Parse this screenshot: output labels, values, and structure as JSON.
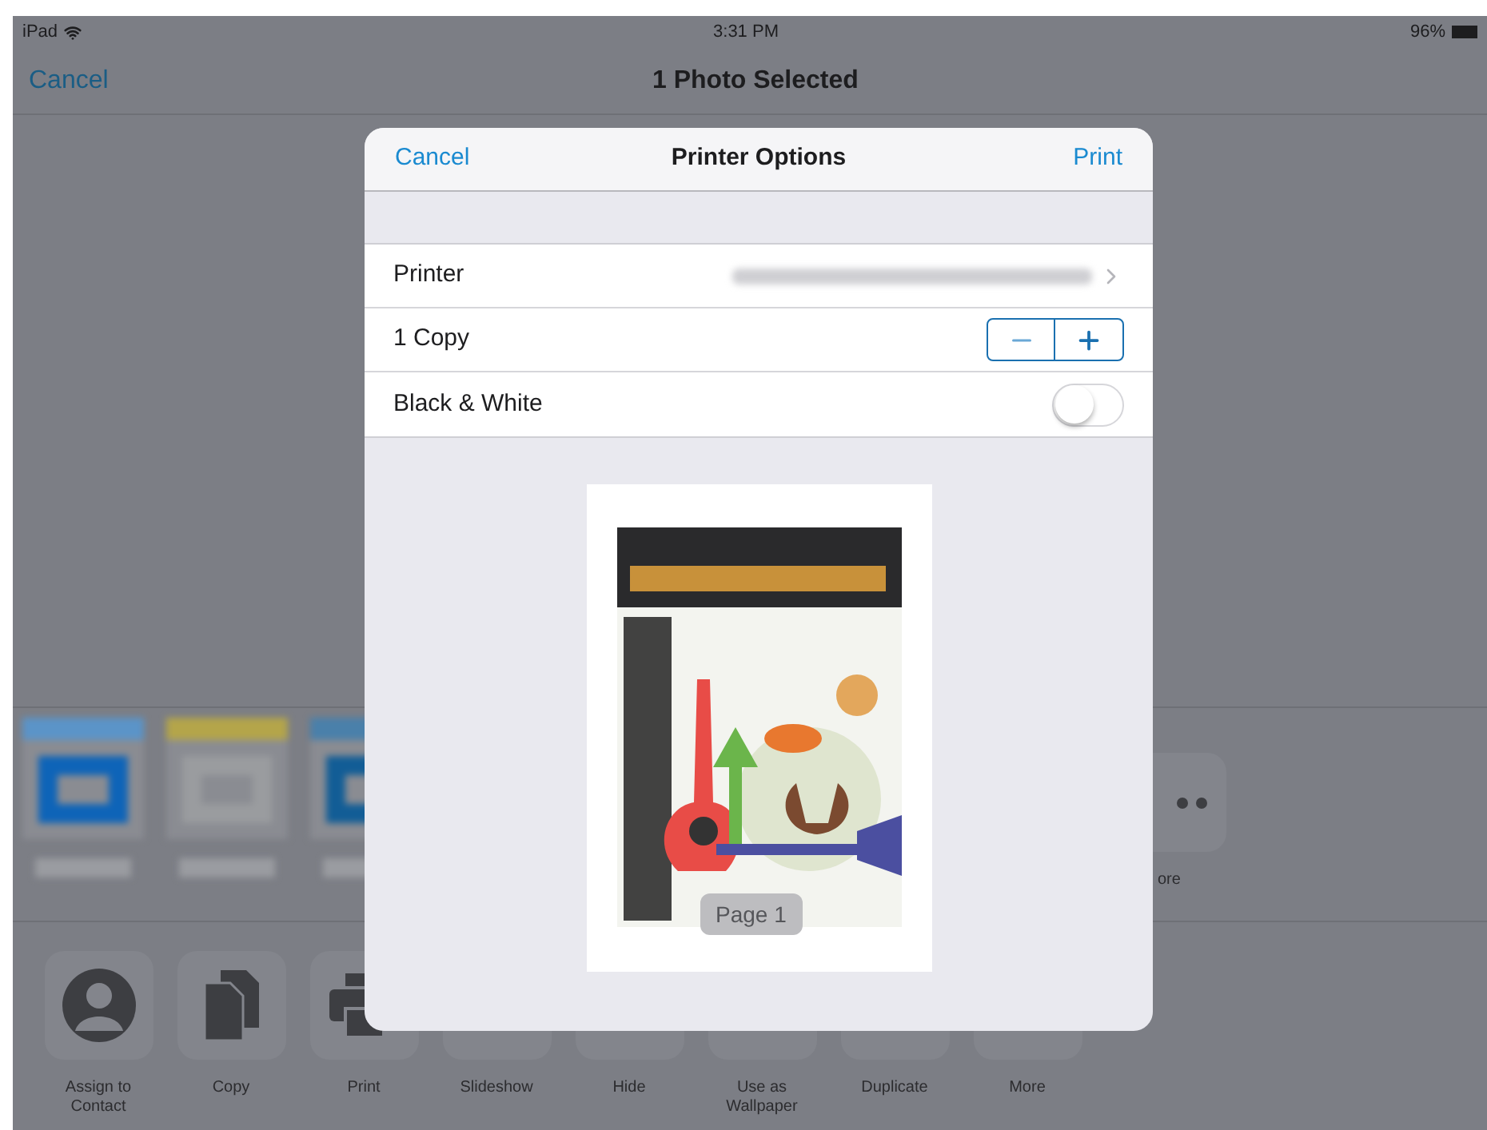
{
  "status_bar": {
    "device": "iPad",
    "time": "3:31 PM",
    "battery": "96%"
  },
  "nav": {
    "cancel": "Cancel",
    "title": "1 Photo Selected"
  },
  "app_row": {
    "more_label": "ore"
  },
  "actions": [
    {
      "label": "Assign to Contact",
      "kind": "person"
    },
    {
      "label": "Copy",
      "kind": "copy"
    },
    {
      "label": "Print",
      "kind": "print"
    },
    {
      "label": "Slideshow"
    },
    {
      "label": "Hide"
    },
    {
      "label": "Use as Wallpaper"
    },
    {
      "label": "Duplicate"
    },
    {
      "label": "More"
    }
  ],
  "dialog": {
    "cancel": "Cancel",
    "title": "Printer Options",
    "print": "Print",
    "printer": {
      "label": "Printer"
    },
    "copies": {
      "label": "1 Copy"
    },
    "black_white": {
      "label": "Black & White",
      "on": false
    },
    "preview": {
      "page": "Page 1"
    }
  }
}
